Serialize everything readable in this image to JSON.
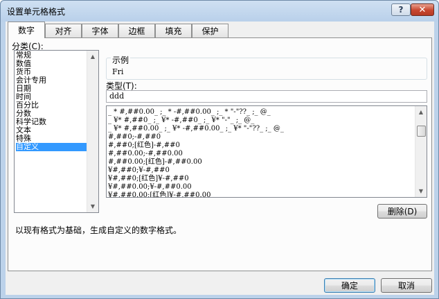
{
  "window": {
    "title": "设置单元格格式",
    "help_label": "?",
    "close_label": "✕"
  },
  "tabs": [
    {
      "label": "数字",
      "active": true
    },
    {
      "label": "对齐",
      "active": false
    },
    {
      "label": "字体",
      "active": false
    },
    {
      "label": "边框",
      "active": false
    },
    {
      "label": "填充",
      "active": false
    },
    {
      "label": "保护",
      "active": false
    }
  ],
  "category": {
    "label": "分类(C):",
    "items": [
      "常规",
      "数值",
      "货币",
      "会计专用",
      "日期",
      "时间",
      "百分比",
      "分数",
      "科学记数",
      "文本",
      "特殊",
      "自定义"
    ],
    "selected_index": 11
  },
  "sample": {
    "label": "示例",
    "value": "Fri"
  },
  "type": {
    "label": "类型(T):",
    "value": "ddd"
  },
  "formats": [
    "_ * #,##0.00_ ;_ * -#,##0.00_ ;_ * \"-\"??_ ;_ @_",
    "_ ¥* #,##0_ ;_ ¥* -#,##0_ ;_ ¥* \"-\"_ ;_ @_",
    "_ ¥* #,##0.00_ ;_ ¥* -#,##0.00_ ;_ ¥* \"-\"??_ ;_ @_",
    "#,##0;-#,##0",
    "#,##0;[红色]-#,##0",
    "#,##0.00;-#,##0.00",
    "#,##0.00;[红色]-#,##0.00",
    "¥#,##0;¥-#,##0",
    "¥#,##0;[红色]¥-#,##0",
    "¥#,##0.00;¥-#,##0.00",
    "¥#,##0.00;[红色]¥-#,##0.00"
  ],
  "buttons": {
    "delete": "删除(D)",
    "ok": "确定",
    "cancel": "取消"
  },
  "description": "以现有格式为基础，生成自定义的数字格式。"
}
